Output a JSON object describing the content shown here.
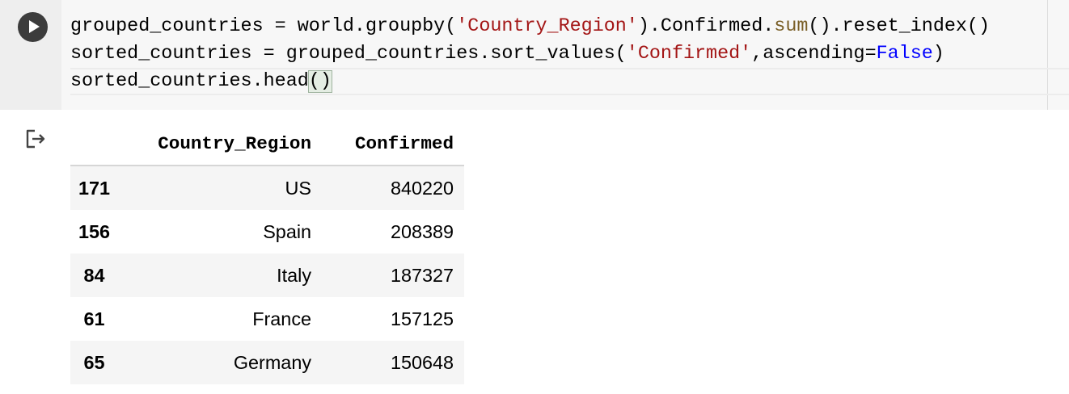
{
  "cell": {
    "run_button_icon": "play-icon",
    "code_lines": [
      [
        {
          "t": "grouped_countries = world.groupby(",
          "c": "plain"
        },
        {
          "t": "'Country_Region'",
          "c": "str"
        },
        {
          "t": ").Confirmed.",
          "c": "plain"
        },
        {
          "t": "sum",
          "c": "builtin"
        },
        {
          "t": "().reset_index()",
          "c": "plain"
        }
      ],
      [
        {
          "t": "sorted_countries = grouped_countries.sort_values(",
          "c": "plain"
        },
        {
          "t": "'Confirmed'",
          "c": "str"
        },
        {
          "t": ",ascending=",
          "c": "plain"
        },
        {
          "t": "False",
          "c": "kw"
        },
        {
          "t": ")",
          "c": "plain"
        }
      ],
      [
        {
          "t": "sorted_countries.head",
          "c": "plain"
        },
        {
          "t": "()",
          "c": "bracket-match"
        }
      ]
    ]
  },
  "output": {
    "icon": "output-redirect-icon",
    "table": {
      "columns": [
        "Country_Region",
        "Confirmed"
      ],
      "rows": [
        {
          "index": "171",
          "Country_Region": "US",
          "Confirmed": "840220"
        },
        {
          "index": "156",
          "Country_Region": "Spain",
          "Confirmed": "208389"
        },
        {
          "index": "84",
          "Country_Region": "Italy",
          "Confirmed": "187327"
        },
        {
          "index": "61",
          "Country_Region": "France",
          "Confirmed": "157125"
        },
        {
          "index": "65",
          "Country_Region": "Germany",
          "Confirmed": "150648"
        }
      ]
    }
  },
  "colors": {
    "string": "#a31515",
    "builtin": "#795e26",
    "keyword": "#0000ff",
    "run_button": "#3c3c3c"
  }
}
